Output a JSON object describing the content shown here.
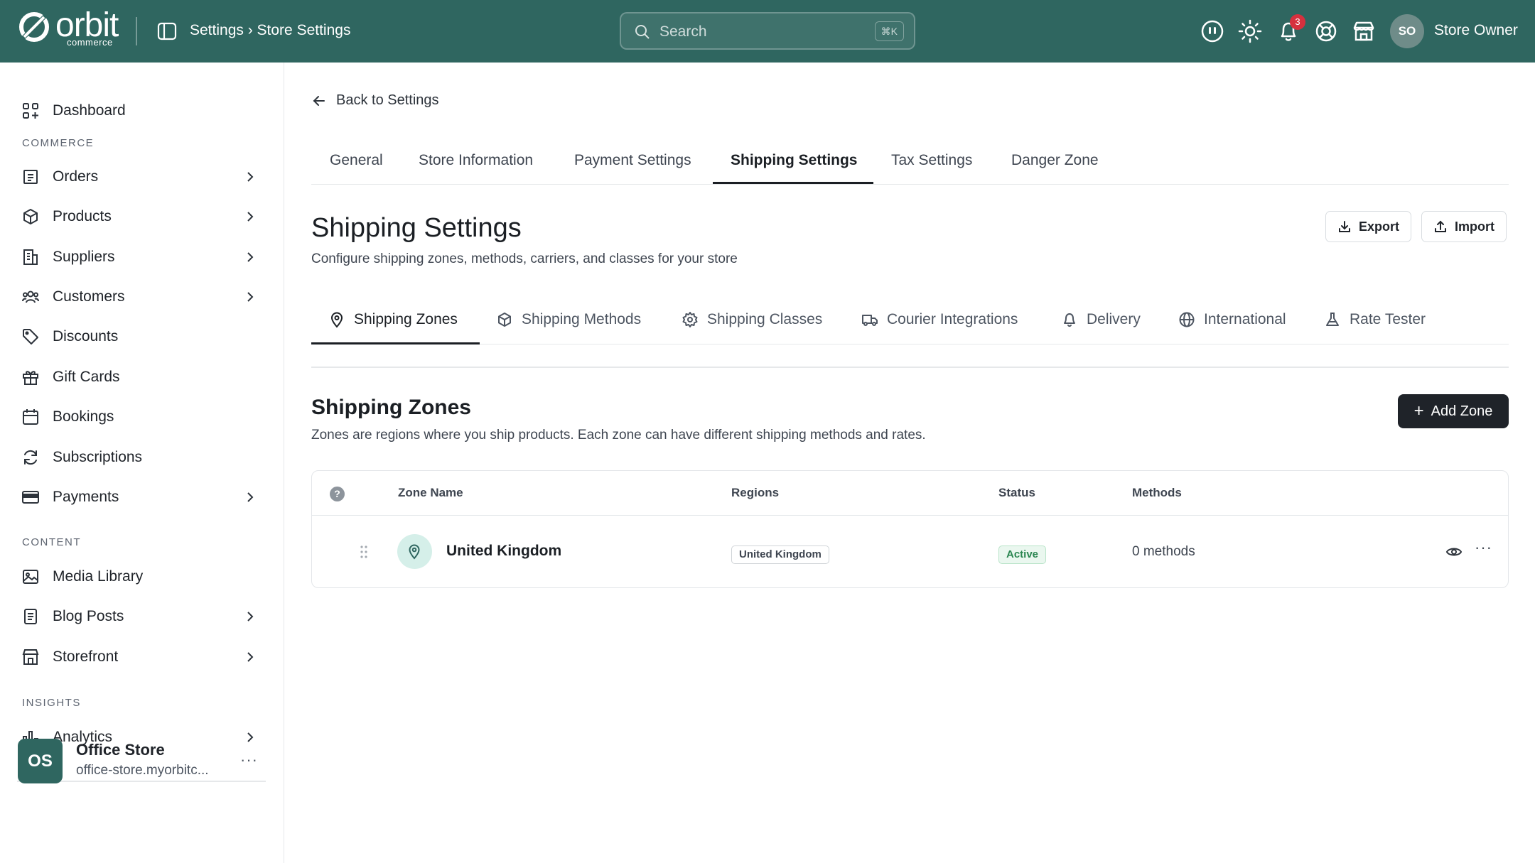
{
  "topbar": {
    "logo_text": "orbit",
    "logo_sub": "commerce",
    "breadcrumb": "Settings › Store Settings",
    "search_placeholder": "Search",
    "search_shortcut": "⌘K",
    "notification_count": "3",
    "user_initials": "SO",
    "user_name": "Store Owner"
  },
  "sidebar": {
    "dashboard": "Dashboard",
    "sections": {
      "commerce": "COMMERCE",
      "content": "CONTENT",
      "insights": "INSIGHTS"
    },
    "items": {
      "orders": "Orders",
      "products": "Products",
      "suppliers": "Suppliers",
      "customers": "Customers",
      "discounts": "Discounts",
      "gift_cards": "Gift Cards",
      "bookings": "Bookings",
      "subscriptions": "Subscriptions",
      "payments": "Payments",
      "media_library": "Media Library",
      "blog_posts": "Blog Posts",
      "storefront": "Storefront",
      "analytics": "Analytics"
    },
    "store": {
      "initials": "OS",
      "name": "Office Store",
      "url": "office-store.myorbitc..."
    }
  },
  "main": {
    "back_label": "Back to Settings",
    "tabs": [
      "General",
      "Store Information",
      "Payment Settings",
      "Shipping Settings",
      "Tax Settings",
      "Danger Zone"
    ],
    "title": "Shipping Settings",
    "subtitle": "Configure shipping zones, methods, carriers, and classes for your store",
    "export_label": "Export",
    "import_label": "Import",
    "subtabs": [
      "Shipping Zones",
      "Shipping Methods",
      "Shipping Classes",
      "Courier Integrations",
      "Delivery",
      "International",
      "Rate Tester"
    ],
    "zones": {
      "heading": "Shipping Zones",
      "description": "Zones are regions where you ship products. Each zone can have different shipping methods and rates.",
      "add_label": "Add Zone",
      "columns": [
        "Zone Name",
        "Regions",
        "Status",
        "Methods"
      ],
      "rows": [
        {
          "name": "United Kingdom",
          "region": "United Kingdom",
          "status": "Active",
          "methods": "0 methods"
        }
      ]
    }
  }
}
